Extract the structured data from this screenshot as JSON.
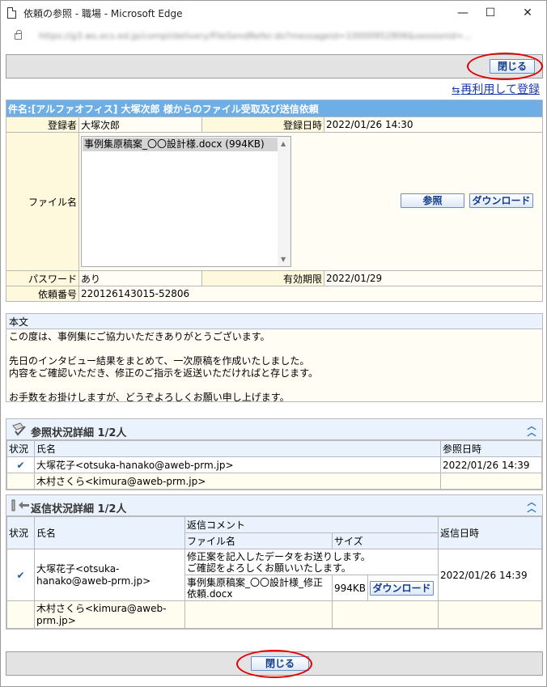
{
  "window": {
    "title": "依頼の参照 - 職場 - Microsoft Edge",
    "minimize": "—",
    "maximize": "☐",
    "close": "✕",
    "url": "https://g3.ws.ecs.ed.jp/compl/delivery/FileSendRefer.do?messageid=10000952806&sessionid=..."
  },
  "toolbar": {
    "close_label": "閉じる"
  },
  "reuse_link": "再利用して登録",
  "subject": "件名:[アルファオフィス] 大塚次郎 様からのファイル受取及び送信依頼",
  "info": {
    "registrant_label": "登録者",
    "registrant": "大塚次郎",
    "registered_label": "登録日時",
    "registered": "2022/01/26 14:30",
    "filename_label": "ファイル名",
    "file": "事例集原稿案_〇〇設計様.docx (994KB)",
    "view_button": "参照",
    "download_button": "ダウンロード",
    "password_label": "パスワード",
    "password": "あり",
    "expiry_label": "有効期限",
    "expiry": "2022/01/29",
    "request_no_label": "依頼番号",
    "request_no": "220126143015-52806"
  },
  "body": {
    "label": "本文",
    "lines": [
      "この度は、事例集にご協力いただきありがとうございます。",
      "",
      "先日のインタビュー結果をまとめて、一次原稿を作成いたしました。",
      "内容をご確認いただき、修正のご指示を返送いただければと存じます。",
      "",
      "お手数をお掛けしますが、どうぞよろしくお願い申し上げます。"
    ]
  },
  "view_status": {
    "title": "参照状況詳細 1/2人",
    "col_status": "状況",
    "col_name": "氏名",
    "col_date": "参照日時",
    "rows": [
      {
        "name": "大塚花子<otsuka-hanako@aweb-prm.jp>",
        "date": "2022/01/26 14:39",
        "checked": true
      },
      {
        "name": "木村さくら<kimura@aweb-prm.jp>",
        "date": "",
        "checked": false
      }
    ]
  },
  "reply_status": {
    "title": "返信状況詳細 1/2人",
    "col_status": "状況",
    "col_name": "氏名",
    "col_comment": "返信コメント",
    "col_file": "ファイル名",
    "col_size": "サイズ",
    "col_date": "返信日時",
    "rows": [
      {
        "name": "大塚花子<otsuka-hanako@aweb-prm.jp>",
        "comment1": "修正案を記入したデータをお送りします。",
        "comment2": "ご確認をよろしくお願いいたします。",
        "file": "事例集原稿案_〇〇設計様_修正依頼.docx",
        "size": "994KB",
        "download": "ダウンロード",
        "date": "2022/01/26 14:39",
        "checked": true
      },
      {
        "name": "木村さくら<kimura@aweb-prm.jp>",
        "checked": false
      }
    ]
  },
  "colors": {
    "accent": "#6eaee6",
    "annotation": "#e00000",
    "link": "#1a38a8"
  },
  "icons": [
    "document-icon",
    "lock-icon",
    "reuse-icon",
    "view-status-icon",
    "reply-status-icon",
    "collapse-icon",
    "check-icon"
  ]
}
